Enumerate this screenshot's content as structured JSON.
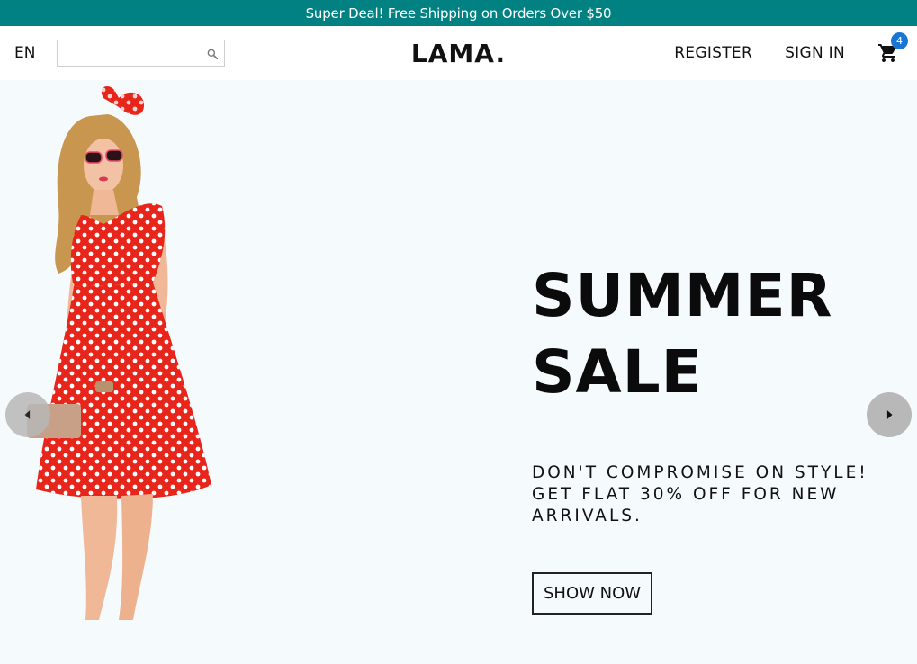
{
  "announcement": {
    "text": "Super Deal! Free Shipping on Orders Over $50"
  },
  "navbar": {
    "language": "EN",
    "search": {
      "value": "",
      "placeholder": "",
      "icon": "search-icon"
    },
    "logo": "LAMA.",
    "register": "REGISTER",
    "sign_in": "SIGN IN",
    "cart": {
      "icon": "shopping-cart-icon",
      "badge_count": "4"
    }
  },
  "hero": {
    "title": "SUMMER\nSALE",
    "description": "DON'T COMPROMISE ON STYLE! GET FLAT 30% OFF FOR NEW ARRIVALS.",
    "cta_label": "SHOW NOW",
    "left_arrow_icon": "arrow-left-icon",
    "right_arrow_icon": "arrow-right-icon",
    "image": "model-in-red-polka-dot-dress"
  },
  "colors": {
    "announcement_bg": "#018181",
    "hero_bg": "#f5fafd",
    "badge_bg": "#1976d2",
    "dress_red": "#e8251a"
  }
}
